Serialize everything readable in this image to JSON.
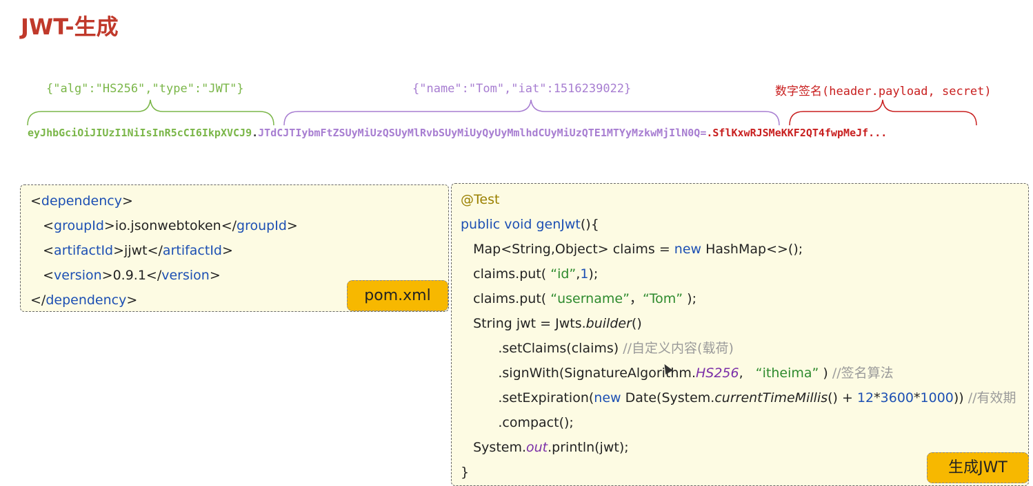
{
  "title": "JWT-生成",
  "header_label": "{\"alg\":\"HS256\",\"type\":\"JWT\"}",
  "payload_label": "{\"name\":\"Tom\",\"iat\":1516239022}",
  "signature_label": "数字签名(header.payload, secret)",
  "token": {
    "header": "eyJhbGciOiJIUzI1NiIsInR5cCI6IkpXVCJ9",
    "sep": ".",
    "payload": "JTdCJTIybmFtZSUyMiUzQSUyMlRvbSUyMiUyQyUyMmlhdCUyMiUzQTE1MTYyMzkwMjIlN0Q=",
    "signature": "SflKxwRJSMeKKF2QT4fwpMeJf..."
  },
  "colors": {
    "green": "#7ab648",
    "purple": "#a77dd1",
    "red": "#c81e1e",
    "title": "#c0392b",
    "tag": "#f7b800",
    "box": "#fdfbe3"
  },
  "pom": {
    "dep_open_lt": "<",
    "dep": "dependency",
    "gt": ">",
    "lt_slash": "</",
    "groupId_tag": "groupId",
    "groupId_val": "io.jsonwebtoken",
    "artifactId_tag": "artifactId",
    "artifactId_val": "jjwt",
    "version_tag": "version",
    "version_val": "0.9.1",
    "tag_label": "pom.xml"
  },
  "code": {
    "annotation": "@Test",
    "public": "public",
    "void": "void",
    "method": "genJwt",
    "method_paren": "(){",
    "l3a": "Map<String,Object> claims = ",
    "new1": "new",
    "l3b": " HashMap<>();",
    "put": "claims.put(",
    "id_key": "“id”",
    "comma": ",",
    "one": "1",
    "close": ");",
    "username_key": "“username”",
    "comma_sp": "，",
    "tom_val": "“Tom”",
    "close_sp": " );",
    "l6a": "String jwt = Jwts.",
    "builder": "builder",
    "l6b": "()",
    "setClaims": ".setClaims(claims) ",
    "cm1": "//自定义内容(载荷)",
    "signWith": ".signWith(SignatureAlgorithm.",
    "hs256": "HS256",
    "sign_comma": ",   ",
    "secret": "“itheima”",
    "sign_close": " ) ",
    "cm2": "//签名算法",
    "setExp": ".setExpiration(",
    "new2": "new",
    "date": " Date(System.",
    "ctm": "currentTimeMillis",
    "plus": "() + ",
    "n12": "12",
    "star": "*",
    "n3600": "3600",
    "n1000": "1000",
    "exp_close": ")) ",
    "cm3": "//有效期",
    "compact": ".compact();",
    "sys": "System.",
    "out": "out",
    "println": ".println(jwt);",
    "end": "}",
    "tag_label": "生成JWT"
  }
}
